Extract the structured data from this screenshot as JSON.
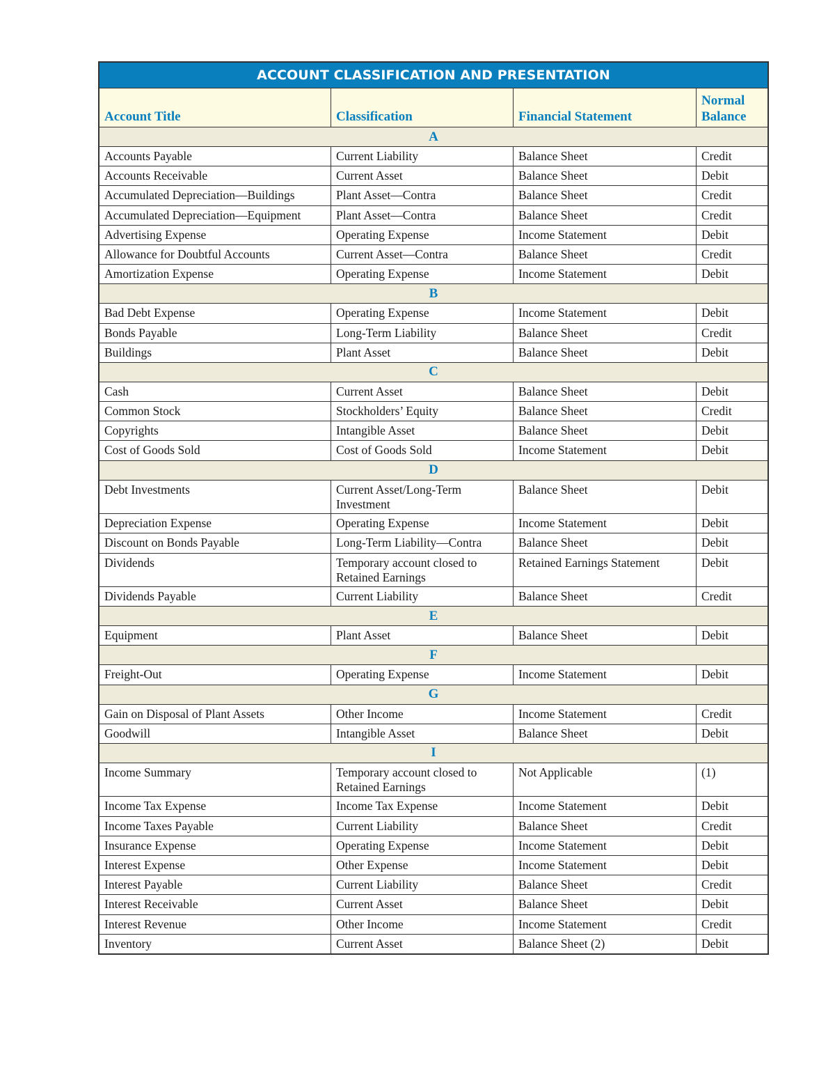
{
  "title": "ACCOUNT CLASSIFICATION AND PRESENTATION",
  "colors": {
    "accent": "#0a7fbd",
    "header_bg": "#fefbe3",
    "section_bg": "#eeebdb"
  },
  "columns": [
    "Account Title",
    "Classification",
    "Financial Statement",
    "Normal Balance"
  ],
  "sections": [
    {
      "letter": "A",
      "rows": [
        [
          "Accounts Payable",
          "Current Liability",
          "Balance Sheet",
          "Credit"
        ],
        [
          "Accounts Receivable",
          "Current Asset",
          "Balance Sheet",
          "Debit"
        ],
        [
          "Accumulated Depreciation—Buildings",
          "Plant Asset—Contra",
          "Balance Sheet",
          "Credit"
        ],
        [
          "Accumulated Depreciation—Equipment",
          "Plant Asset—Contra",
          "Balance Sheet",
          "Credit"
        ],
        [
          "Advertising Expense",
          "Operating Expense",
          "Income Statement",
          "Debit"
        ],
        [
          "Allowance for Doubtful Accounts",
          "Current Asset—Contra",
          "Balance Sheet",
          "Credit"
        ],
        [
          "Amortization Expense",
          "Operating Expense",
          "Income Statement",
          "Debit"
        ]
      ]
    },
    {
      "letter": "B",
      "rows": [
        [
          "Bad Debt Expense",
          "Operating Expense",
          "Income Statement",
          "Debit"
        ],
        [
          "Bonds Payable",
          "Long-Term Liability",
          "Balance Sheet",
          "Credit"
        ],
        [
          "Buildings",
          "Plant Asset",
          "Balance Sheet",
          "Debit"
        ]
      ]
    },
    {
      "letter": "C",
      "rows": [
        [
          "Cash",
          "Current Asset",
          "Balance Sheet",
          "Debit"
        ],
        [
          "Common Stock",
          "Stockholders’ Equity",
          "Balance Sheet",
          "Credit"
        ],
        [
          "Copyrights",
          "Intangible Asset",
          "Balance Sheet",
          "Debit"
        ],
        [
          "Cost of Goods Sold",
          "Cost of Goods Sold",
          "Income Statement",
          "Debit"
        ]
      ]
    },
    {
      "letter": "D",
      "rows": [
        [
          "Debt Investments",
          "Current Asset/Long-Term Investment",
          "Balance Sheet",
          "Debit"
        ],
        [
          "Depreciation Expense",
          "Operating Expense",
          "Income Statement",
          "Debit"
        ],
        [
          "Discount on Bonds Payable",
          "Long-Term Liability—Contra",
          "Balance Sheet",
          "Debit"
        ],
        [
          "Dividends",
          "Temporary account closed to  Retained Earnings",
          "Retained Earnings Statement",
          "Debit"
        ],
        [
          "Dividends Payable",
          "Current Liability",
          "Balance Sheet",
          "Credit"
        ]
      ]
    },
    {
      "letter": "E",
      "rows": [
        [
          "Equipment",
          "Plant Asset",
          "Balance Sheet",
          "Debit"
        ]
      ]
    },
    {
      "letter": "F",
      "rows": [
        [
          "Freight-Out",
          "Operating Expense",
          "Income Statement",
          "Debit"
        ]
      ]
    },
    {
      "letter": "G",
      "rows": [
        [
          "Gain on Disposal of Plant Assets",
          "Other Income",
          "Income Statement",
          "Credit"
        ],
        [
          "Goodwill",
          "Intangible Asset",
          "Balance Sheet",
          "Debit"
        ]
      ]
    },
    {
      "letter": "I",
      "rows": [
        [
          "Income Summary",
          "Temporary account closed to Retained Earnings",
          "Not Applicable",
          "(1)"
        ],
        [
          "Income Tax Expense",
          "Income Tax Expense",
          "Income Statement",
          "Debit"
        ],
        [
          "Income Taxes Payable",
          "Current Liability",
          "Balance Sheet",
          "Credit"
        ],
        [
          "Insurance Expense",
          "Operating Expense",
          "Income Statement",
          "Debit"
        ],
        [
          "Interest Expense",
          "Other Expense",
          "Income Statement",
          "Debit"
        ],
        [
          "Interest Payable",
          "Current Liability",
          "Balance Sheet",
          "Credit"
        ],
        [
          "Interest Receivable",
          "Current Asset",
          "Balance Sheet",
          "Debit"
        ],
        [
          "Interest Revenue",
          "Other Income",
          "Income Statement",
          "Credit"
        ],
        [
          "Inventory",
          "Current Asset",
          "Balance Sheet (2)",
          "Debit"
        ]
      ]
    }
  ]
}
